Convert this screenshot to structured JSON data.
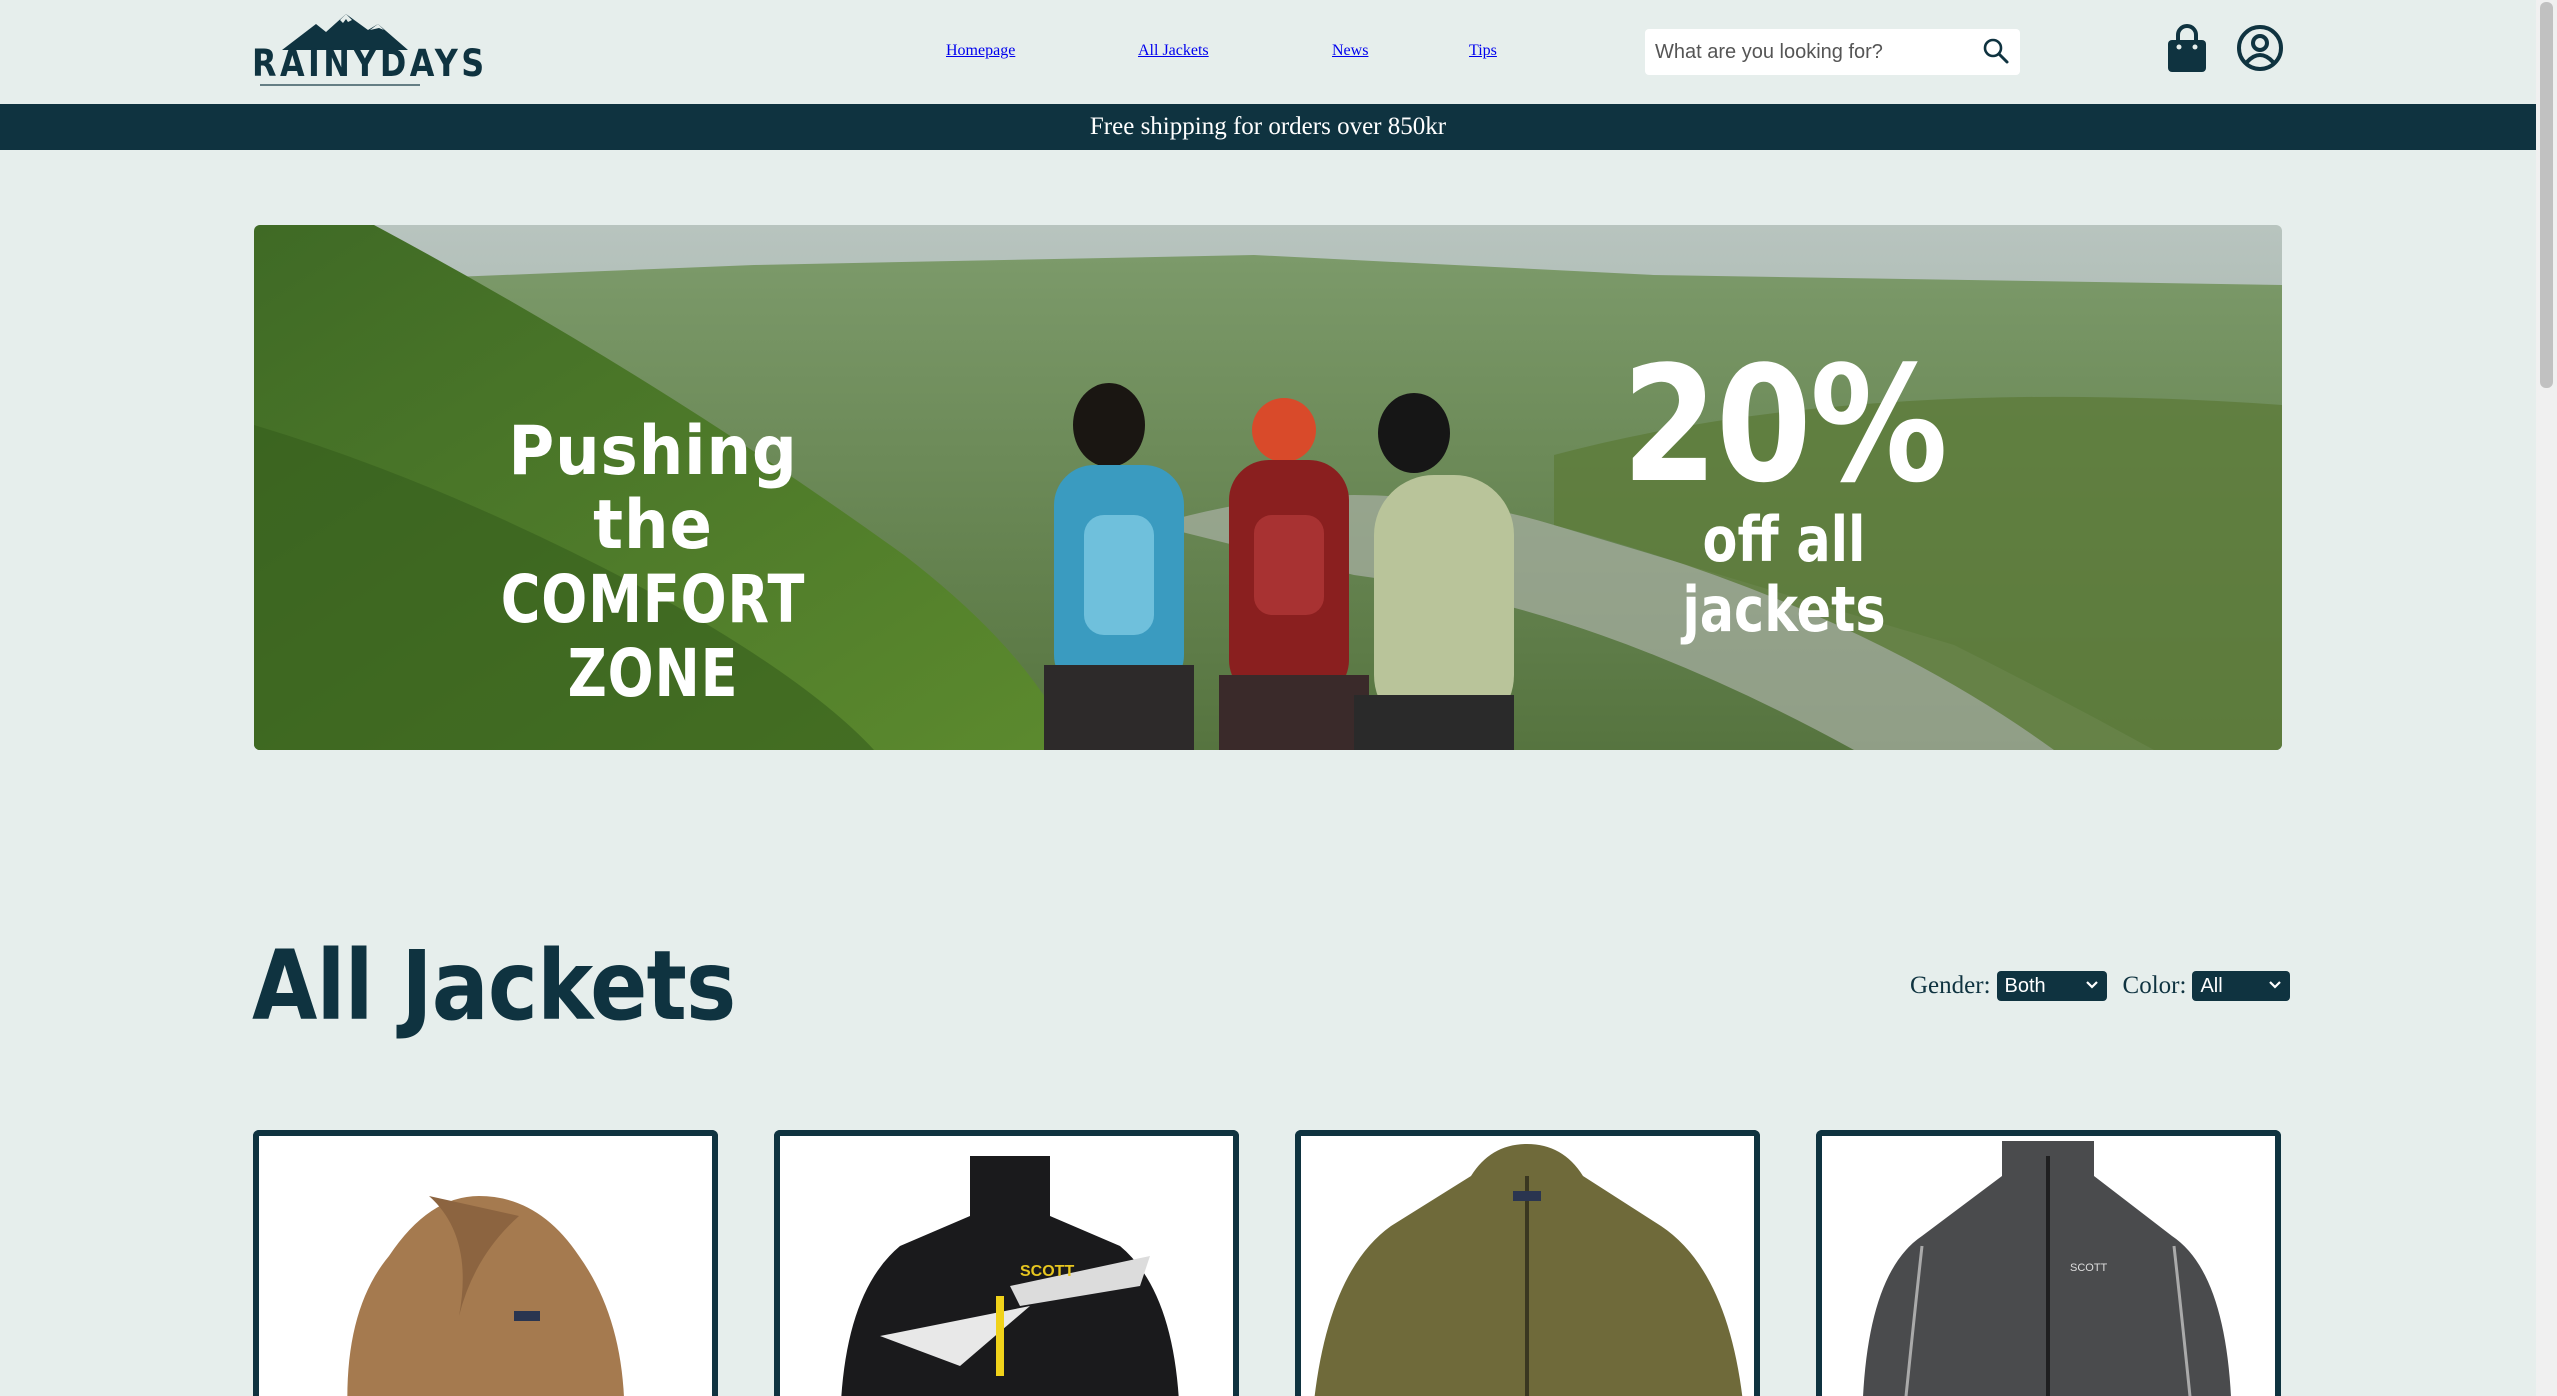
{
  "header": {
    "logo_text": "RAINYDAYS",
    "nav": [
      {
        "label": "Homepage"
      },
      {
        "label": "All Jackets"
      },
      {
        "label": "News"
      },
      {
        "label": "Tips"
      }
    ],
    "search": {
      "placeholder": "What are you looking for?",
      "value": ""
    },
    "icons": {
      "search": "search-icon",
      "cart": "shopping-bag-icon",
      "account": "user-circle-icon"
    }
  },
  "promo_bar": {
    "text": "Free shipping for orders over 850kr"
  },
  "hero": {
    "left_line1": "Pushing the",
    "left_line2": "COMFORT ZONE",
    "right_big": "20%",
    "right_small": "off all jackets"
  },
  "section": {
    "title": "All Jackets",
    "filters": {
      "gender_label": "Gender:",
      "gender_value": "Both",
      "color_label": "Color:",
      "color_value": "All"
    }
  },
  "products": [
    {
      "image": "brown-fleece-jacket"
    },
    {
      "image": "black-scott-snow-jacket"
    },
    {
      "image": "olive-fleece-jacket"
    },
    {
      "image": "grey-scott-shell-jacket"
    }
  ],
  "colors": {
    "brand_dark": "#0f3340",
    "background": "#e6eeec",
    "white": "#ffffff"
  }
}
